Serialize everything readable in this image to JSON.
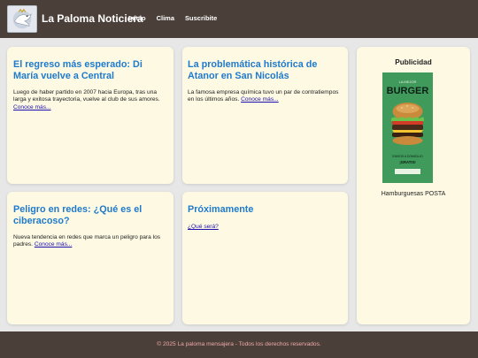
{
  "header": {
    "site_title": "La Paloma Noticiera",
    "nav": [
      "Inicio",
      "Clima",
      "Suscribite"
    ]
  },
  "articles": [
    {
      "title": "El regreso más esperado: Di María vuelve a Central",
      "body": "Luego de haber partido en 2007 hacia Europa, tras una larga y exitosa trayectoria, vuelve al club de sus amores.",
      "link": "Conoce más..."
    },
    {
      "title": "La problemática histórica de Atanor en San Nicolás",
      "body": "La famosa empresa química tuvo un par de contratiempos en los últimos años.",
      "link": "Conoce más..."
    },
    {
      "title": "Peligro en redes: ¿Qué es el ciberacoso?",
      "body": "Nueva tendencia en redes que marca un peligro para los padres.",
      "link": "Conoce más..."
    },
    {
      "title": "Próximamente",
      "link": "¿Qué será?"
    }
  ],
  "ad": {
    "title": "Publicidad",
    "caption": "Hamburguesas POSTA",
    "image_text": {
      "top": "LA MEJOR",
      "main": "BURGER",
      "bottom1": "ENVÍOS A DOMICILIO",
      "bottom2": "¡GRATIS!"
    }
  },
  "footer": {
    "text": "© 2025 La paloma mensajera - Todos los derechos reservados."
  }
}
